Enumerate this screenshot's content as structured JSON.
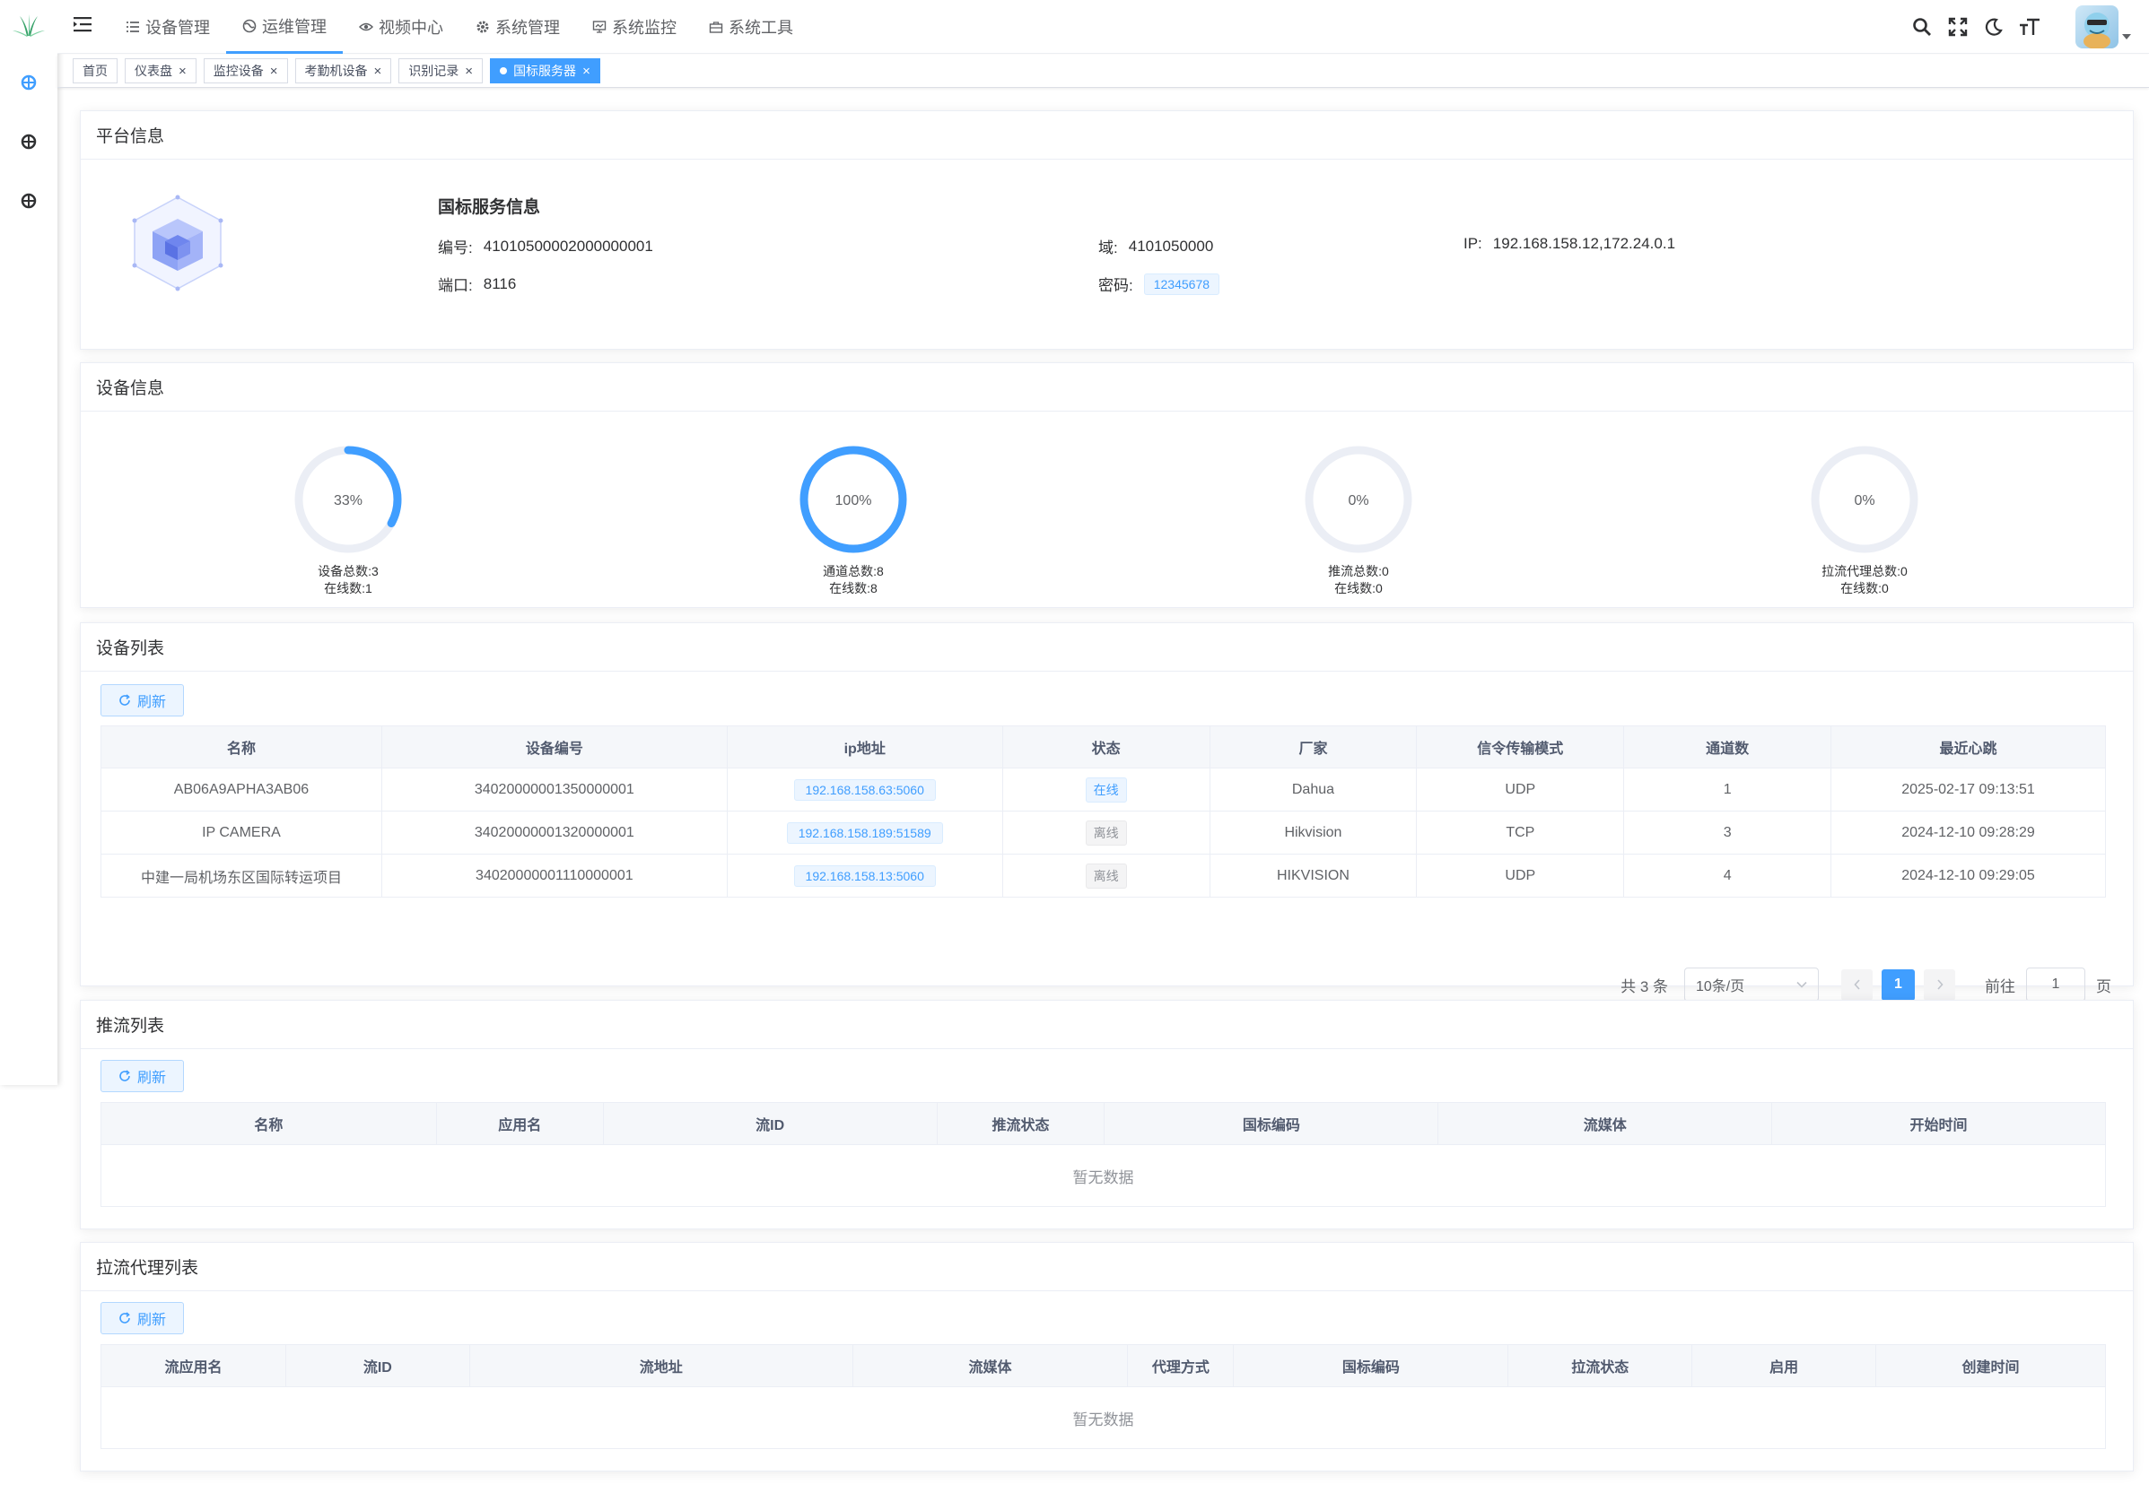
{
  "header": {
    "menu": [
      {
        "label": "设备管理",
        "icon": "list-icon"
      },
      {
        "label": "运维管理",
        "icon": "globe-icon"
      },
      {
        "label": "视频中心",
        "icon": "eye-icon"
      },
      {
        "label": "系统管理",
        "icon": "gear-icon"
      },
      {
        "label": "系统监控",
        "icon": "monitor-icon"
      },
      {
        "label": "系统工具",
        "icon": "toolbox-icon"
      }
    ],
    "active_menu": "运维管理"
  },
  "tabs": [
    {
      "label": "首页",
      "closable": false
    },
    {
      "label": "仪表盘",
      "closable": true
    },
    {
      "label": "监控设备",
      "closable": true
    },
    {
      "label": "考勤机设备",
      "closable": true
    },
    {
      "label": "识别记录",
      "closable": true
    },
    {
      "label": "国标服务器",
      "closable": true,
      "active": true
    }
  ],
  "platform": {
    "section_title": "平台信息",
    "title": "国标服务信息",
    "id_label": "编号:",
    "id_value": "41010500002000000001",
    "domain_label": "域:",
    "domain_value": "4101050000",
    "ip_label": "IP:",
    "ip_value": "192.168.158.12,172.24.0.1",
    "port_label": "端口:",
    "port_value": "8116",
    "pw_label": "密码:",
    "pw_value": "12345678"
  },
  "devices_info": {
    "section_title": "设备信息",
    "gauges": [
      {
        "percent": 33,
        "label": "33%",
        "line1": "设备总数:3",
        "line2": "在线数:1"
      },
      {
        "percent": 100,
        "label": "100%",
        "line1": "通道总数:8",
        "line2": "在线数:8"
      },
      {
        "percent": 0,
        "label": "0%",
        "line1": "推流总数:0",
        "line2": "在线数:0"
      },
      {
        "percent": 0,
        "label": "0%",
        "line1": "拉流代理总数:0",
        "line2": "在线数:0"
      }
    ]
  },
  "device_list": {
    "section_title": "设备列表",
    "refresh_label": "刷新",
    "columns": [
      "名称",
      "设备编号",
      "ip地址",
      "状态",
      "厂家",
      "信令传输模式",
      "通道数",
      "最近心跳"
    ],
    "rows": [
      {
        "name": "AB06A9APHA3AB06",
        "code": "34020000001350000001",
        "ip": "192.168.158.63:5060",
        "status": "在线",
        "online": true,
        "vendor": "Dahua",
        "transport": "UDP",
        "channels": "1",
        "heartbeat": "2025-02-17 09:13:51"
      },
      {
        "name": "IP CAMERA",
        "code": "34020000001320000001",
        "ip": "192.168.158.189:51589",
        "status": "离线",
        "online": false,
        "vendor": "Hikvision",
        "transport": "TCP",
        "channels": "3",
        "heartbeat": "2024-12-10 09:28:29"
      },
      {
        "name": "中建一局机场东区国际转运项目",
        "code": "34020000001110000001",
        "ip": "192.168.158.13:5060",
        "status": "离线",
        "online": false,
        "vendor": "HIKVISION",
        "transport": "UDP",
        "channels": "4",
        "heartbeat": "2024-12-10 09:29:05"
      }
    ],
    "pager": {
      "total": "共 3 条",
      "page_size": "10条/页",
      "current": "1",
      "goto_prefix": "前往",
      "goto_value": "1",
      "goto_suffix": "页"
    }
  },
  "push_list": {
    "section_title": "推流列表",
    "refresh_label": "刷新",
    "columns": [
      "名称",
      "应用名",
      "流ID",
      "推流状态",
      "国标编码",
      "流媒体",
      "开始时间"
    ],
    "empty": "暂无数据"
  },
  "proxy_list": {
    "section_title": "拉流代理列表",
    "refresh_label": "刷新",
    "columns": [
      "流应用名",
      "流ID",
      "流地址",
      "流媒体",
      "代理方式",
      "国标编码",
      "拉流状态",
      "启用",
      "创建时间"
    ],
    "empty": "暂无数据"
  },
  "colors": {
    "primary": "#409eff",
    "track": "#ebeef5"
  }
}
